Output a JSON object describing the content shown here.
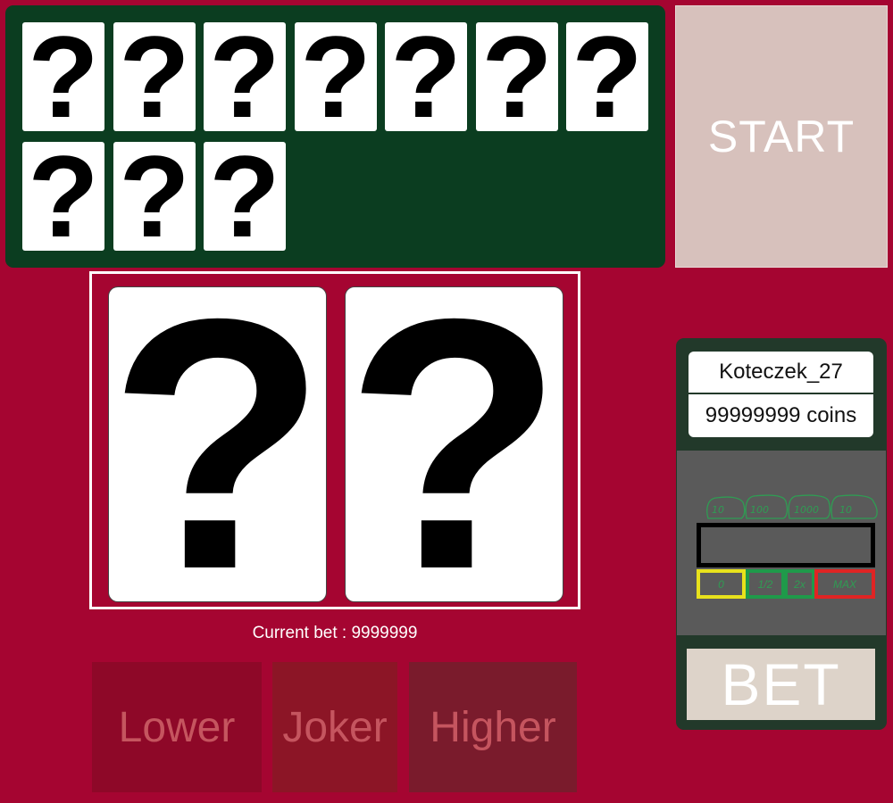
{
  "deck": {
    "cards": [
      "?",
      "?",
      "?",
      "?",
      "?",
      "?",
      "?",
      "?",
      "?",
      "?"
    ]
  },
  "start_label": "START",
  "table": {
    "left_card": "?",
    "right_card": "?"
  },
  "current_bet_text": "Current bet : 9999999",
  "guess": {
    "lower_label": "Lower",
    "joker_label": "Joker",
    "higher_label": "Higher"
  },
  "player": {
    "name": "Koteczek_27",
    "coins": "99999999 coins"
  },
  "bet_controls": {
    "chip_labels": [
      "10",
      "100",
      "1000",
      "10"
    ],
    "option_labels": [
      "0",
      "1/2",
      "2x",
      "MAX"
    ]
  },
  "bet_label": "BET",
  "colors": {
    "background": "#a50531",
    "deck_felt": "#0b3d20",
    "panel": "#22392a",
    "start": "#d7c1bc",
    "sketch_green": "#2f9c53",
    "sketch_yellow": "#e8e21c",
    "sketch_red": "#e02424"
  }
}
